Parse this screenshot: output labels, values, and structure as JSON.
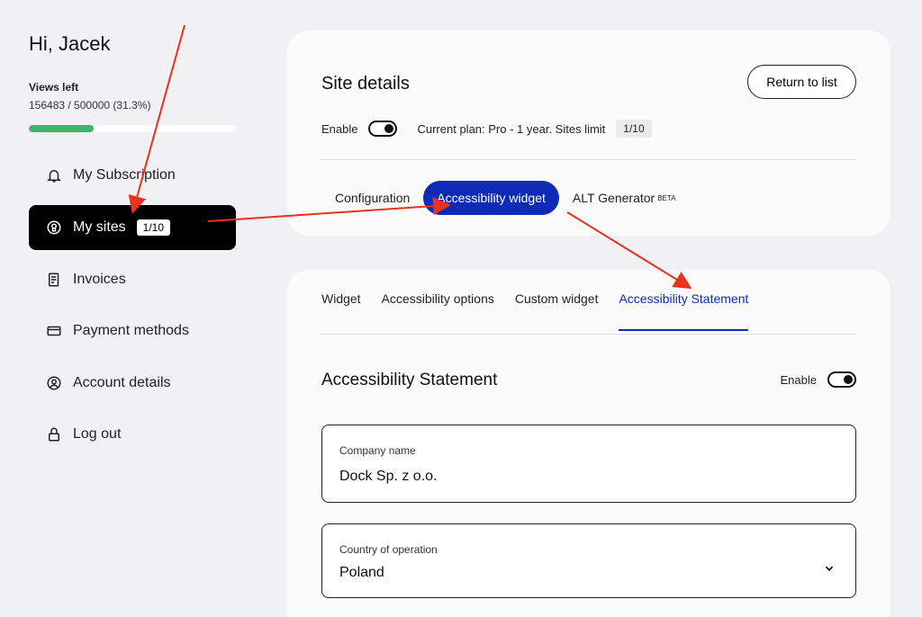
{
  "sidebar": {
    "greeting": "Hi, Jacek",
    "views_label": "Views left",
    "views_value": "156483 / 500000 (31.3%)",
    "views_fraction": 0.313,
    "progress_color": "#38b86a",
    "nav": [
      {
        "label": "My Subscription",
        "icon": "bell-icon"
      },
      {
        "label": "My sites",
        "icon": "site-icon",
        "badge": "1/10",
        "active": true
      },
      {
        "label": "Invoices",
        "icon": "invoice-icon"
      },
      {
        "label": "Payment methods",
        "icon": "credit-card-icon"
      },
      {
        "label": "Account details",
        "icon": "user-circle-icon"
      },
      {
        "label": "Log out",
        "icon": "lock-icon"
      }
    ]
  },
  "site": {
    "title": "Site details",
    "return_label": "Return to list",
    "enable_label": "Enable",
    "plan_text": "Current plan: Pro - 1 year. Sites limit",
    "plan_badge": "1/10",
    "tabs": [
      {
        "label": "Configuration"
      },
      {
        "label": "Accessibility widget",
        "active": true
      },
      {
        "label": "ALT Generator",
        "sup": "BETA"
      }
    ]
  },
  "widget": {
    "subtabs": [
      {
        "label": "Widget"
      },
      {
        "label": "Accessibility options"
      },
      {
        "label": "Custom widget"
      },
      {
        "label": "Accessibility Statement",
        "active": true
      }
    ],
    "section_title": "Accessibility Statement",
    "enable_label": "Enable",
    "company_label": "Company name",
    "company_value": "Dock Sp. z o.o.",
    "country_label": "Country of operation",
    "country_value": "Poland"
  },
  "colors": {
    "accent": "#0e2bb8",
    "annotation_arrow": "#e8321e"
  }
}
